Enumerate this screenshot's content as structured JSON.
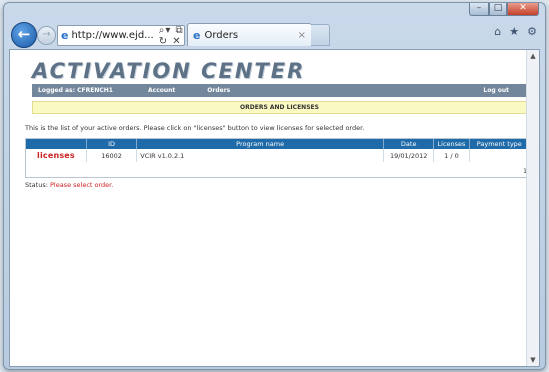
{
  "browser": {
    "address": "http://www.ejd...",
    "tab_title": "Orders",
    "colors": {
      "accent": "#1f6aa8",
      "nav": "#73879c",
      "banner": "#fbf9c2",
      "error": "#cc2222"
    }
  },
  "app": {
    "logo": "ACTIVATION CENTER",
    "nav": {
      "logged_as": "Logged as: CFRENCH1",
      "account": "Account",
      "orders": "Orders",
      "logout": "Log out"
    },
    "section_title": "ORDERS AND LICENSES",
    "info": "This is the list of your active orders. Please click on \"licenses\" button to view licenses for selected order.",
    "table": {
      "headers": [
        "",
        "ID",
        "Program name",
        "Date",
        "Licenses",
        "Payment type"
      ],
      "rows": [
        {
          "action": "licenses",
          "id": "16002",
          "program": "VCIR v1.0.2.1",
          "date": "19/01/2012",
          "licenses": "1 / 0",
          "payment": ""
        }
      ],
      "page": "1"
    },
    "status_label": "Status:",
    "status_message": "Please select order."
  }
}
